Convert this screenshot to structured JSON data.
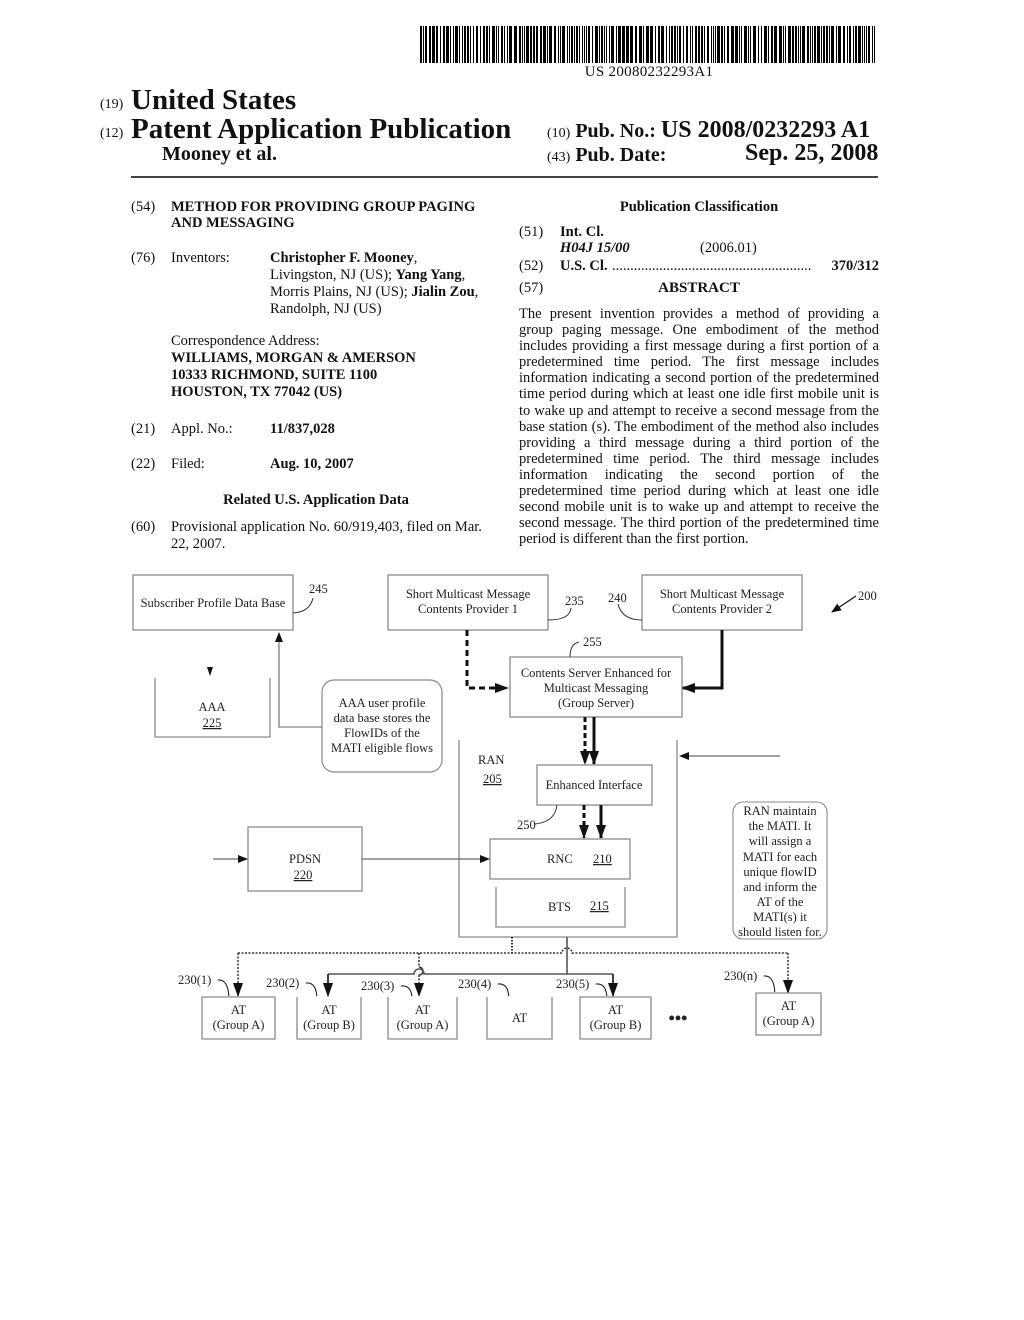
{
  "header": {
    "barcode_number": "US 20080232293A1",
    "country_code": "(19)",
    "country": "United States",
    "doc_type_code": "(12)",
    "doc_type": "Patent Application Publication",
    "authors": "Mooney et al.",
    "pub_no_code": "(10)",
    "pub_no_label": "Pub. No.:",
    "pub_no": "US 2008/0232293 A1",
    "pub_date_code": "(43)",
    "pub_date_label": "Pub. Date:",
    "pub_date": "Sep. 25, 2008"
  },
  "biblio": {
    "title_code": "(54)",
    "title": "METHOD FOR PROVIDING GROUP PAGING AND MESSAGING",
    "inventors_code": "(76)",
    "inventors_label": "Inventors:",
    "inventors": [
      {
        "name": "Christopher F. Mooney",
        "location": "Livingston, NJ (US)"
      },
      {
        "name": "Yang Yang",
        "location": "Morris Plains, NJ (US)"
      },
      {
        "name": "Jialin Zou",
        "location": "Randolph, NJ (US)"
      }
    ],
    "inventors_lines": {
      "l1_name": "Christopher F. Mooney",
      "l1_rest": ",",
      "l2_pre": "Livingston, NJ (US); ",
      "l2_name": "Yang Yang",
      "l2_rest": ",",
      "l3_pre": "Morris Plains, NJ (US); ",
      "l3_name": "Jialin Zou",
      "l3_rest": ",",
      "l4": "Randolph, NJ (US)"
    },
    "correspondence_label": "Correspondence Address:",
    "correspondence": [
      "WILLIAMS, MORGAN & AMERSON",
      "10333 RICHMOND, SUITE 1100",
      "HOUSTON, TX 77042 (US)"
    ],
    "appl_code": "(21)",
    "appl_label": "Appl. No.:",
    "appl_no": "11/837,028",
    "filed_code": "(22)",
    "filed_label": "Filed:",
    "filed": "Aug. 10, 2007",
    "related_heading": "Related U.S. Application Data",
    "provisional_code": "(60)",
    "provisional_line1": "Provisional application No. 60/919,403, filed on Mar.",
    "provisional_line2": "22, 2007."
  },
  "classification": {
    "heading": "Publication Classification",
    "int_cl_code": "(51)",
    "int_cl_label": "Int. Cl.",
    "int_cl_value": "H04J 15/00",
    "int_cl_version": "(2006.01)",
    "us_cl_code": "(52)",
    "us_cl_label": "U.S. Cl.",
    "us_cl_dots": "........................................................",
    "us_cl_value": "370/312",
    "abstract_code": "(57)",
    "abstract_heading": "ABSTRACT",
    "abstract": "The present invention provides a method of providing a group paging message. One embodiment of the method includes providing a first message during a first portion of a predetermined time period. The first message includes information indicating a second portion of the predetermined time period during which at least one idle first mobile unit is to wake up and attempt to receive a second message from the base station (s). The embodiment of the method also includes providing a third message during a third portion of the predetermined time period. The third message includes information indicating the second portion of the predetermined time period during which at least one idle second mobile unit is to wake up and attempt to receive the second message. The third portion of the predetermined time period is different than the first portion."
  },
  "diagram": {
    "figure_ref": "200",
    "subscriber_db": {
      "label": "Subscriber Profile Data Base",
      "ref": "245"
    },
    "provider1": {
      "line1": "Short Multicast Message",
      "line2": "Contents Provider 1",
      "ref": "235"
    },
    "provider2": {
      "line1": "Short Multicast Message",
      "line2": "Contents Provider 2",
      "ref": "240"
    },
    "group_server": {
      "line1": "Contents Server Enhanced for",
      "line2": "Multicast Messaging",
      "line3": "(Group Server)",
      "ref": "255"
    },
    "aaa": {
      "label": "AAA",
      "ref": "225"
    },
    "aaa_note": {
      "line1": "AAA user profile",
      "line2": "data base stores the",
      "line3": "FlowIDs of the",
      "line4": "MATI eligible flows"
    },
    "ran": {
      "label": "RAN",
      "ref": "205"
    },
    "enhanced_interface": {
      "label": "Enhanced Interface",
      "ref": "250"
    },
    "rnc": {
      "label": "RNC",
      "ref": "210"
    },
    "bts": {
      "label": "BTS",
      "ref": "215"
    },
    "pdsn": {
      "label": "PDSN",
      "ref": "220"
    },
    "ran_note": {
      "line1": "RAN maintain",
      "line2": "the MATI.  It",
      "line3": "will assign a",
      "line4": "MATI for each",
      "line5": "unique flowID",
      "line6": "and inform the",
      "line7": "AT of the",
      "line8": "MATI(s) it",
      "line9": "should listen for."
    },
    "terminals": [
      {
        "ref": "230(1)",
        "line1": "AT",
        "line2": "(Group A)"
      },
      {
        "ref": "230(2)",
        "line1": "AT",
        "line2": "(Group B)"
      },
      {
        "ref": "230(3)",
        "line1": "AT",
        "line2": "(Group A)"
      },
      {
        "ref": "230(4)",
        "line1": "AT",
        "line2": ""
      },
      {
        "ref": "230(5)",
        "line1": "AT",
        "line2": "(Group B)"
      },
      {
        "ref": "230(n)",
        "line1": "AT",
        "line2": "(Group A)"
      }
    ],
    "ellipsis": "•••"
  }
}
